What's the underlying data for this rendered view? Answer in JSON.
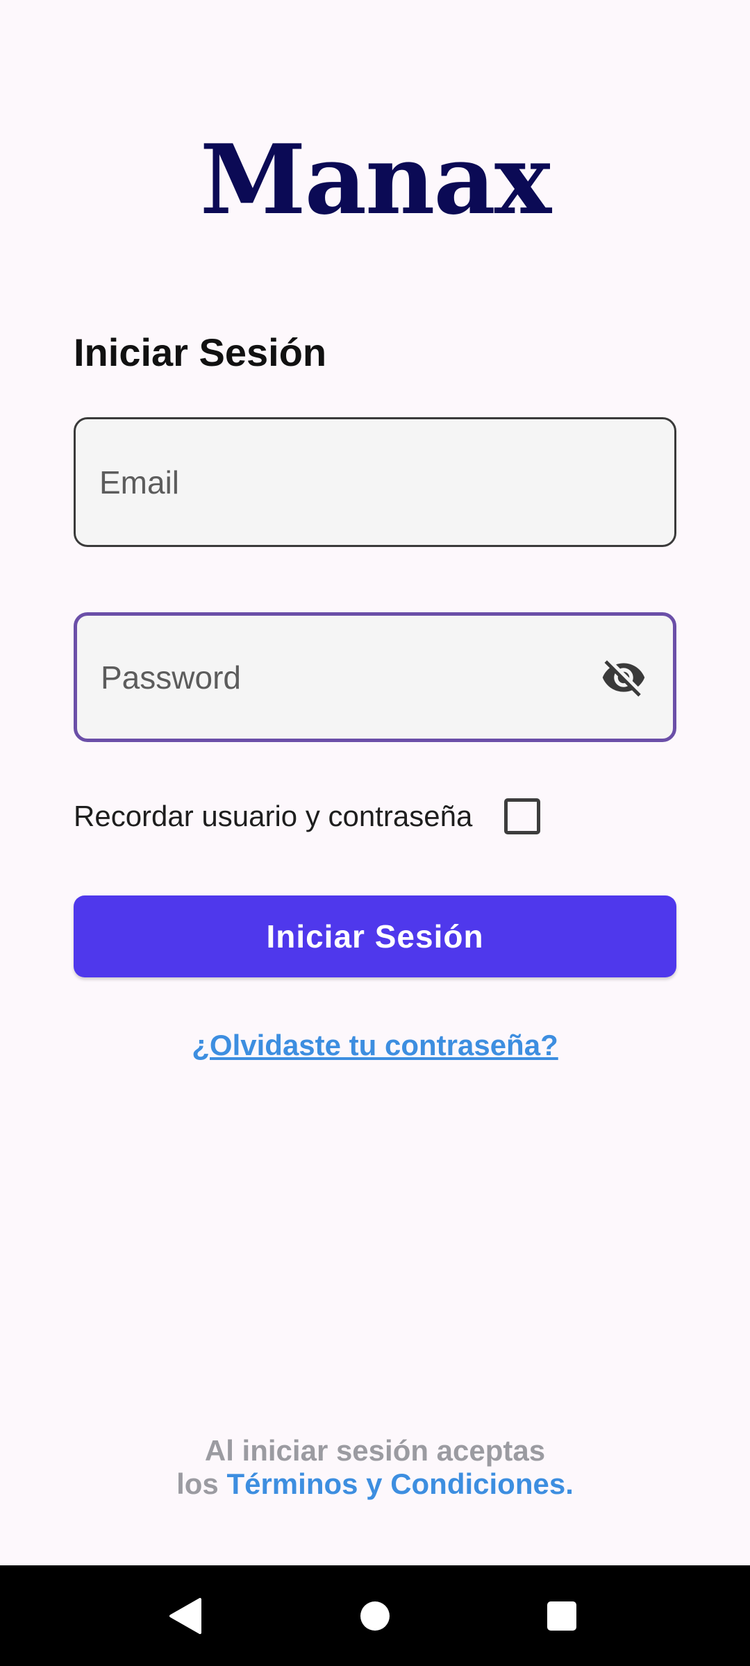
{
  "app": {
    "logo_text": "Manax"
  },
  "login": {
    "title": "Iniciar Sesión",
    "email_placeholder": "Email",
    "email_value": "",
    "password_placeholder": "Password",
    "password_value": "",
    "password_visibility_icon": "visibility-off-icon",
    "remember_label": "Recordar usuario y contraseña",
    "remember_checked": false,
    "submit_label": "Iniciar Sesión",
    "forgot_label": "¿Olvidaste tu contraseña?"
  },
  "footer": {
    "terms_line1": "Al iniciar sesión aceptas",
    "terms_line2_prefix": "los ",
    "terms_link": "Términos y Condiciones."
  },
  "nav": {
    "back_icon": "back-triangle-icon",
    "home_icon": "home-circle-icon",
    "recents_icon": "recents-square-icon"
  },
  "colors": {
    "background": "#fdf8fc",
    "logo": "#0b0a55",
    "primary_button": "#4f38ec",
    "link": "#3d8ee0",
    "focused_border": "#6b4fa8",
    "muted_text": "#9b9ba1"
  }
}
